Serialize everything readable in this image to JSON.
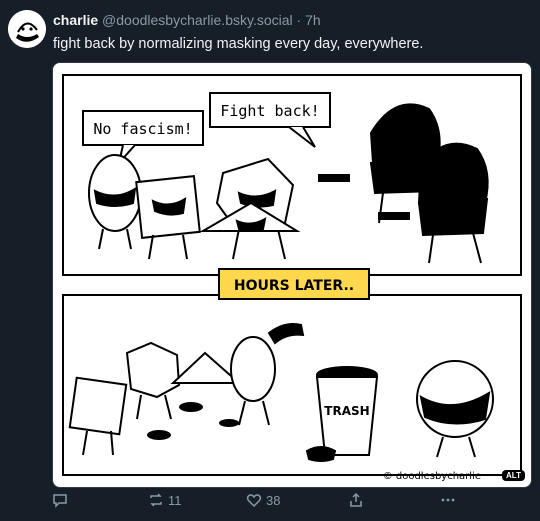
{
  "post": {
    "author_name": "charlie",
    "handle": "@doodlesbycharlie.bsky.social",
    "separator": "·",
    "time": "7h",
    "text": "fight back by normalizing masking every day, everywhere."
  },
  "comic": {
    "bubble_left": "No fascism!",
    "bubble_right": "Fight back!",
    "caption": "HOURS LATER..",
    "trash_label": "TRASH",
    "credit": "© doodlesbycharlie",
    "alt_badge": "ALT"
  },
  "actions": {
    "reply_count": "",
    "repost_count": "11",
    "like_count": "38"
  },
  "colors": {
    "background": "#161e27",
    "caption_bg": "#ffd84d",
    "muted": "#8b98a5"
  }
}
